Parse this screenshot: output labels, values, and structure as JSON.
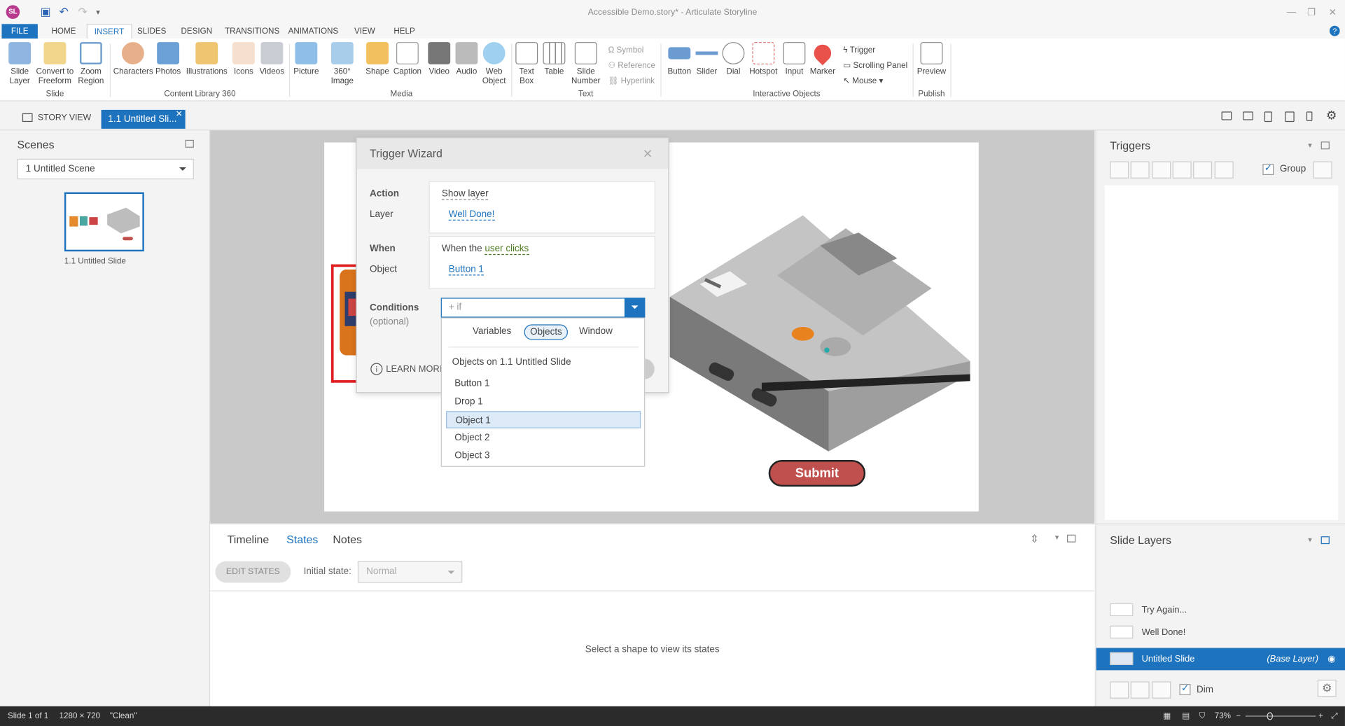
{
  "window": {
    "title": "Accessible Demo.story* - Articulate Storyline",
    "logo": "SL"
  },
  "menu": [
    "FILE",
    "HOME",
    "INSERT",
    "SLIDES",
    "DESIGN",
    "TRANSITIONS",
    "ANIMATIONS",
    "VIEW",
    "HELP"
  ],
  "ribbon": {
    "slide_group": {
      "label": "Slide",
      "items": [
        "Slide Layer",
        "Convert to Freeform",
        "Zoom Region"
      ]
    },
    "content_group": {
      "label": "Content Library 360",
      "items": [
        "Characters",
        "Photos",
        "Illustrations",
        "Icons",
        "Videos"
      ]
    },
    "media_group": {
      "label": "Media",
      "items": [
        "Picture",
        "360° Image",
        "Shape",
        "Caption",
        "Video",
        "Audio",
        "Web Object"
      ]
    },
    "text_group": {
      "label": "Text",
      "items": [
        "Text Box",
        "Table",
        "Slide Number"
      ],
      "small": [
        "Symbol",
        "Reference",
        "Hyperlink"
      ]
    },
    "interactive_group": {
      "label": "Interactive Objects",
      "items": [
        "Button",
        "Slider",
        "Dial",
        "Hotspot",
        "Input",
        "Marker"
      ],
      "small": [
        "Trigger",
        "Scrolling Panel",
        "Mouse"
      ]
    },
    "publish_group": {
      "label": "Publish",
      "items": [
        "Preview"
      ]
    }
  },
  "tabs": {
    "story_view": "STORY VIEW",
    "slide_tab": "1.1 Untitled Sli..."
  },
  "scenes": {
    "title": "Scenes",
    "selected": "1 Untitled Scene",
    "thumb_label": "1.1 Untitled Slide"
  },
  "slide": {
    "submit_label": "Submit"
  },
  "wizard": {
    "title": "Trigger Wizard",
    "action_label": "Action",
    "action_value": "Show layer",
    "layer_label": "Layer",
    "layer_value": "Well Done!",
    "when_label": "When",
    "when_prefix": "When the",
    "when_value": "user clicks",
    "object_label": "Object",
    "object_value": "Button 1",
    "conditions_label": "Conditions",
    "conditions_sub": "(optional)",
    "conditions_placeholder": "+ if",
    "learn_more": "LEARN MORE"
  },
  "conditions_dropdown": {
    "tabs": [
      "Variables",
      "Objects",
      "Window"
    ],
    "heading": "Objects on 1.1 Untitled Slide",
    "items": [
      "Button 1",
      "Drop 1",
      "Object 1",
      "Object 2",
      "Object 3"
    ],
    "highlighted": "Object 1"
  },
  "bottom": {
    "tabs": [
      "Timeline",
      "States",
      "Notes"
    ],
    "edit_states": "EDIT STATES",
    "initial_state_label": "Initial state:",
    "initial_state_value": "Normal",
    "empty_message": "Select a shape to view its states"
  },
  "triggers": {
    "title": "Triggers",
    "group_label": "Group"
  },
  "layers": {
    "title": "Slide Layers",
    "items": [
      "Try Again...",
      "Well Done!"
    ],
    "base_name": "Untitled Slide",
    "base_tag": "(Base Layer)",
    "dim_label": "Dim"
  },
  "status": {
    "slide": "Slide 1 of 1",
    "size": "1280 × 720",
    "theme": "\"Clean\"",
    "zoom": "73%"
  }
}
